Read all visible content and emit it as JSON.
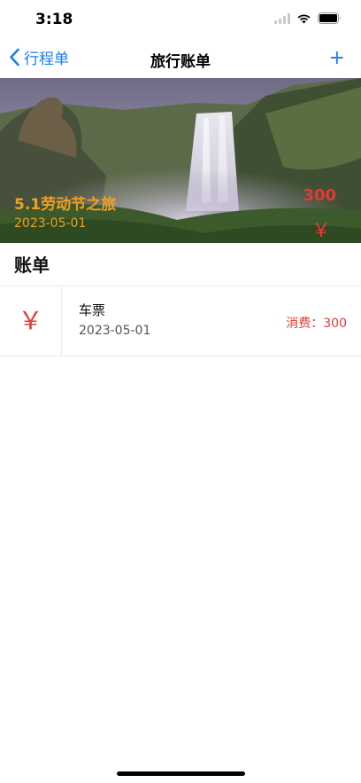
{
  "status_bar": {
    "time": "3:18"
  },
  "nav": {
    "back_label": "行程单",
    "title": "旅行账单",
    "add_label": "+"
  },
  "trip": {
    "name": "5.1劳动节之旅",
    "date": "2023-05-01",
    "total": "300",
    "currency_symbol": "￥"
  },
  "section_title": "账单",
  "bills": [
    {
      "currency_symbol": "￥",
      "name": "车票",
      "date": "2023-05-01",
      "amount_prefix": "消费：",
      "amount": "300"
    }
  ],
  "colors": {
    "accent": "#1a7ef2",
    "trip_text": "#f0a020",
    "amount": "#e53935"
  }
}
